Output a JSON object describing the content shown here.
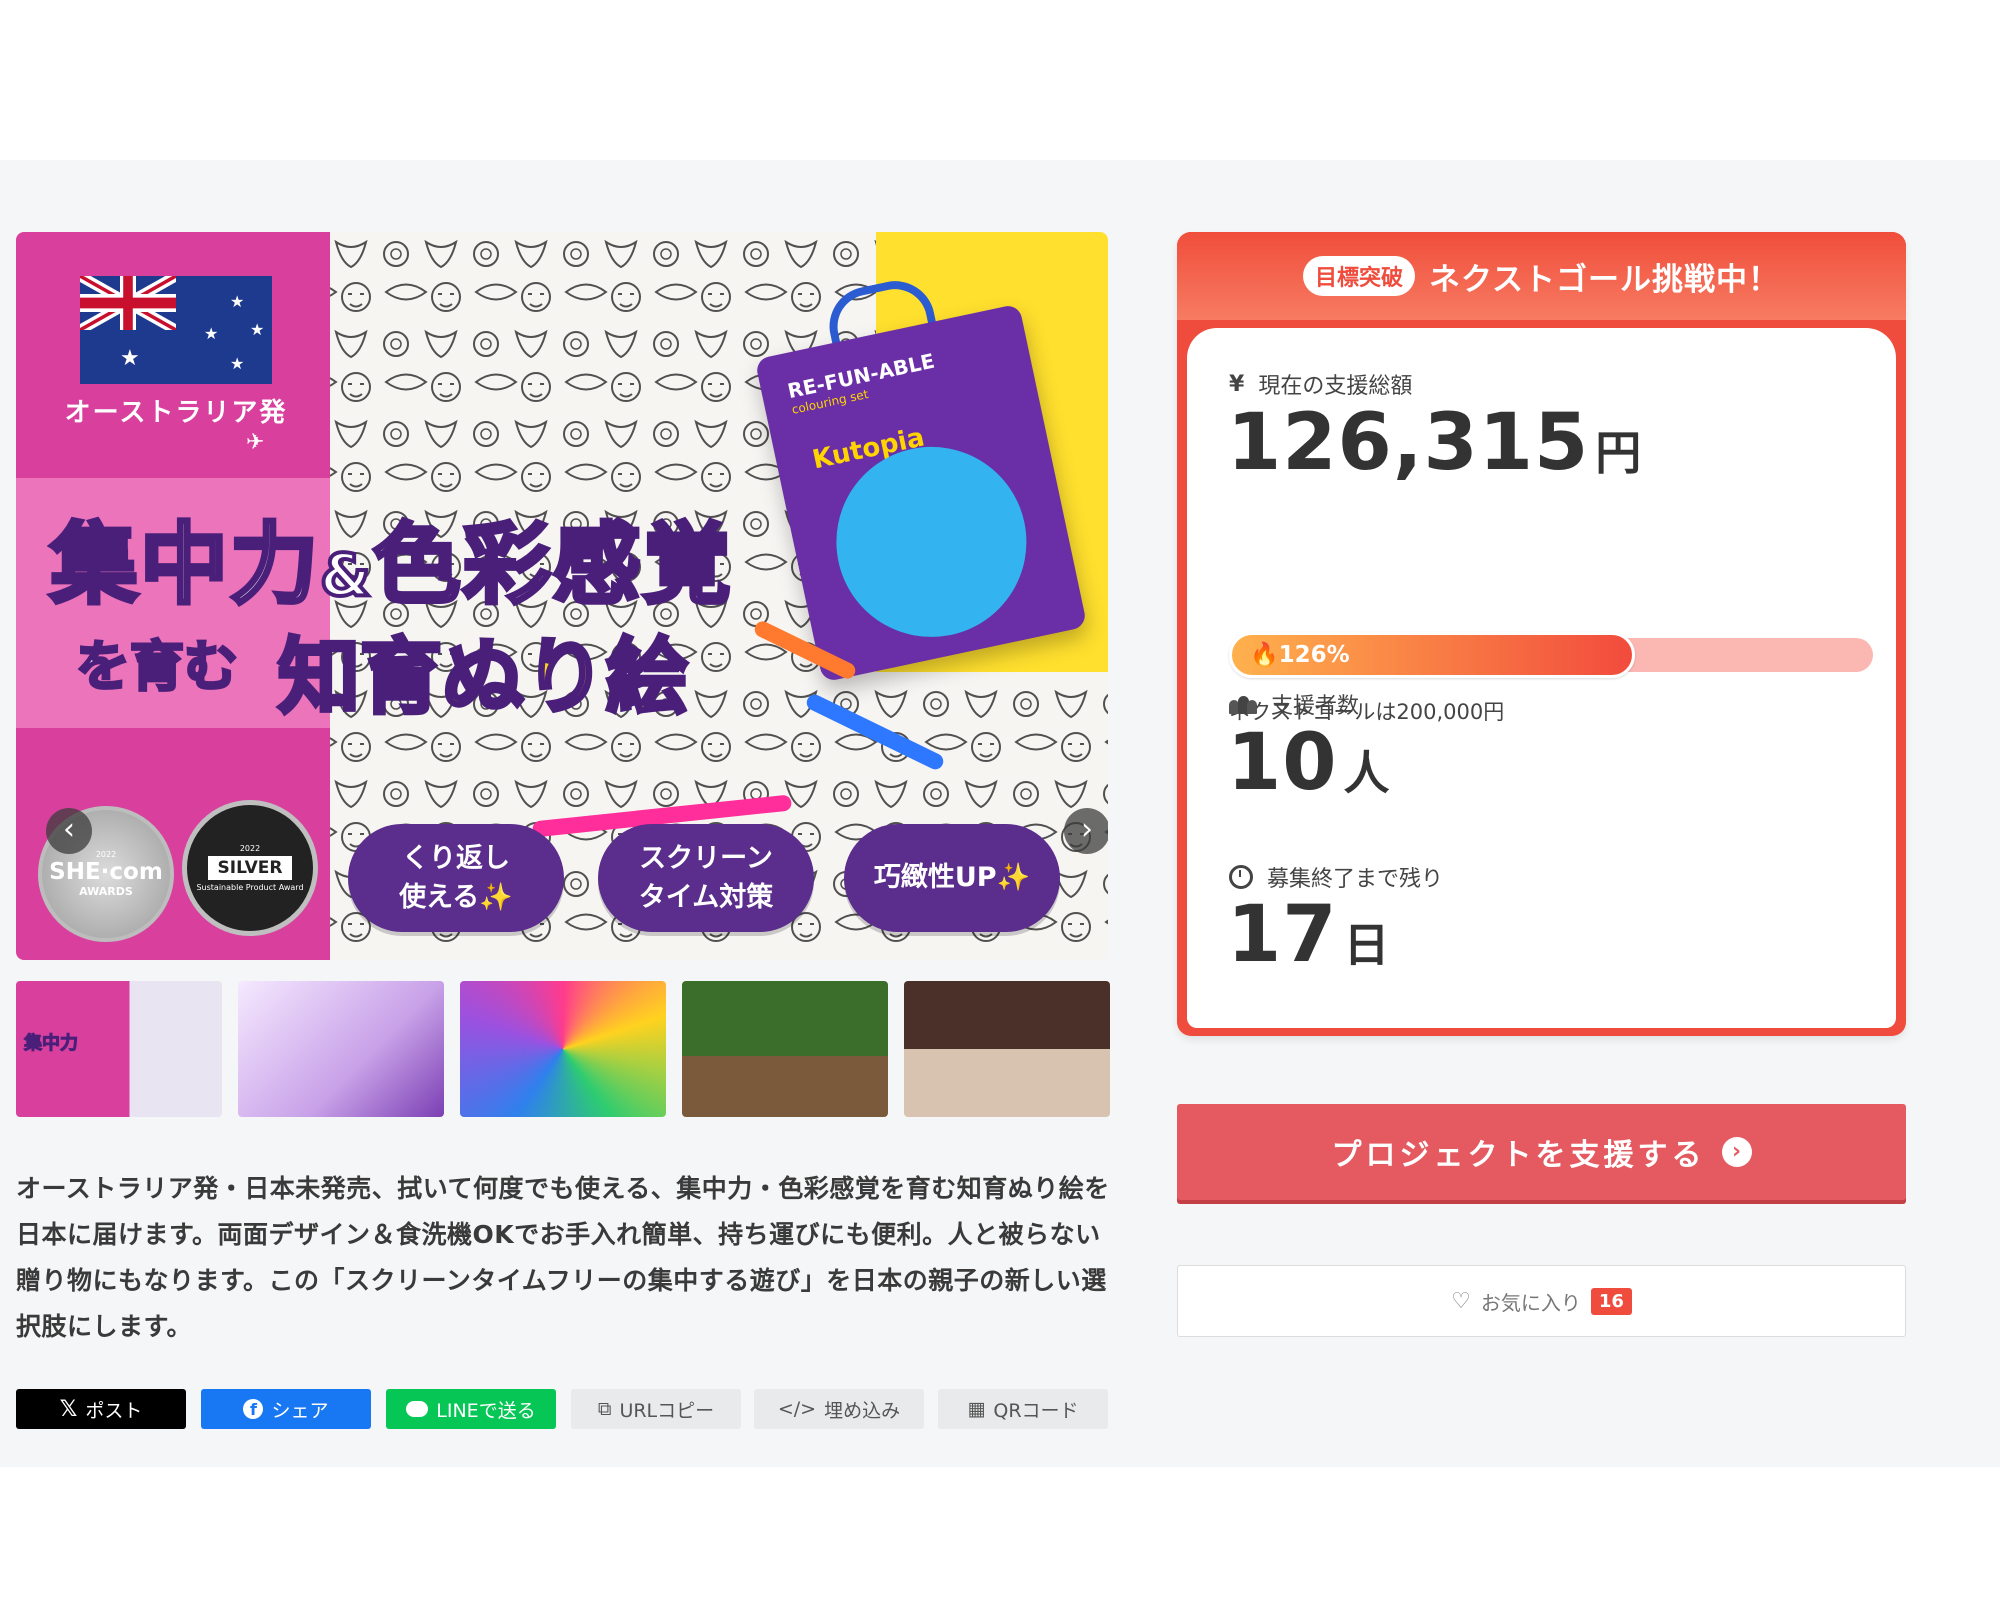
{
  "main_image": {
    "origin": "オーストラリア発",
    "headline_part1": "集中力",
    "amp": "&",
    "headline_part2": "色彩感覚",
    "headline_line2": "を育む",
    "headline_highlight": "知育ぬり絵",
    "award1_title": "SHE·com",
    "award1_sub": "AWARDS",
    "award1_year": "2022",
    "award2_year": "2022",
    "award2_title": "SILVER",
    "award2_sub": "Sustainable Product Award",
    "pills": [
      "くり返し\n使える✨",
      "スクリーン\nタイム対策",
      "巧緻性UP✨"
    ],
    "product_title": "RE-FUN-ABLE",
    "product_sub": "colouring set",
    "product_brand": "Kutopia"
  },
  "thumbnails": [
    "thumbnail-1",
    "thumbnail-2",
    "thumbnail-3",
    "thumbnail-4",
    "thumbnail-5"
  ],
  "description": "オーストラリア発・日本未発売、拭いて何度でも使える、集中力・色彩感覚を育む知育ぬり絵を日本に届けます。両面デザイン＆食洗機OKでお手入れ簡単、持ち運びにも便利。人と被らない贈り物にもなります。この「スクリーンタイムフリーの集中する遊び」を日本の親子の新しい選択肢にします。",
  "share": {
    "x": "ポスト",
    "facebook": "シェア",
    "line": "LINEで送る",
    "url_copy": "URLコピー",
    "embed": "埋め込み",
    "qr": "QRコード"
  },
  "funding": {
    "badge": "目標突破",
    "title": "ネクストゴール挑戦中！",
    "amount_label": "現在の支援総額",
    "currency_symbol": "¥",
    "amount": "126,315",
    "amount_unit": "円",
    "progress_text": "126%",
    "progress_fraction": 0.63,
    "next_goal": "ネクストゴールは200,000円",
    "backers_label": "支援者数",
    "backers": "10",
    "backers_unit": "人",
    "remaining_label": "募集終了まで残り",
    "remaining": "17",
    "remaining_unit": "日"
  },
  "support_button": "プロジェクトを支援する",
  "favorite": {
    "label": "お気に入り",
    "count": "16"
  },
  "colors": {
    "accent": "#ef4c3d",
    "support_button": "#e45a60",
    "headline_purple": "#5b2d8c",
    "banner_pink": "#d9409e"
  }
}
